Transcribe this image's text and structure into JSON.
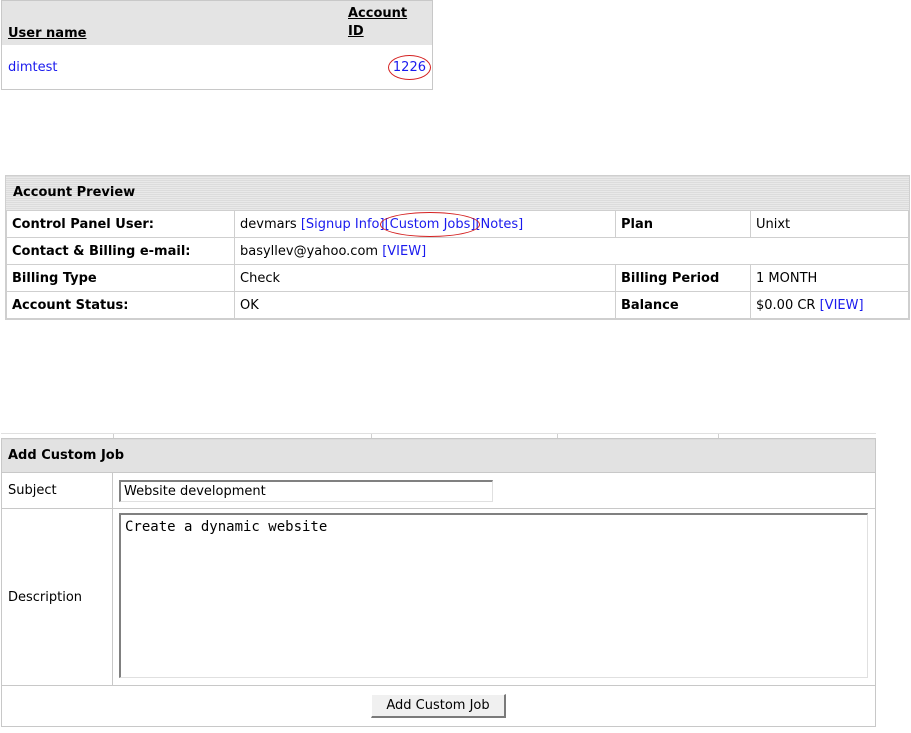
{
  "users_table": {
    "headers": {
      "user_name": "User name",
      "account_id": "Account ID"
    },
    "rows": [
      {
        "user_name": "dimtest",
        "account_id": "1226"
      }
    ]
  },
  "account_preview": {
    "title": "Account Preview",
    "control_panel_user": {
      "label": "Control Panel User:",
      "value": "devmars",
      "links": [
        "[Signup Info]",
        "[Custom Jobs]",
        "[Notes]"
      ]
    },
    "plan": {
      "label": "Plan",
      "value": "Unixt"
    },
    "contact_email": {
      "label": "Contact & Billing e-mail:",
      "value": "basyllev@yahoo.com",
      "link": "[VIEW]"
    },
    "billing_type": {
      "label": "Billing Type",
      "value": "Check"
    },
    "billing_period": {
      "label": "Billing Period",
      "value": "1 MONTH"
    },
    "account_status": {
      "label": "Account Status:",
      "value": "OK"
    },
    "balance": {
      "label": "Balance",
      "value": "$0.00 CR",
      "link": "[VIEW]"
    }
  },
  "add_custom_job": {
    "title": "Add Custom Job",
    "subject_label": "Subject",
    "subject_value": "Website development",
    "description_label": "Description",
    "description_value": "Create a dynamic website",
    "submit_label": "Add Custom Job"
  },
  "colors": {
    "link": "#1a1aee",
    "annotation_circle": "#d42020",
    "header_bg": "#e4e4e4"
  }
}
